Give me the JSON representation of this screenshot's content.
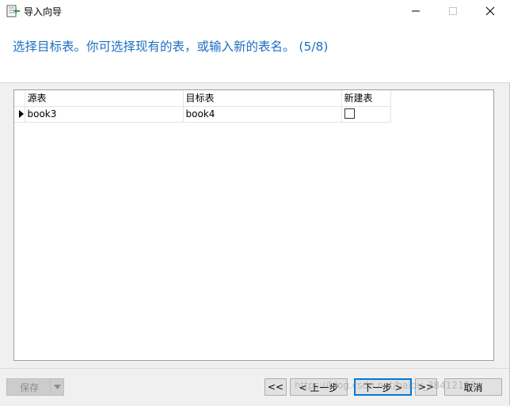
{
  "window": {
    "title": "导入向导"
  },
  "header": {
    "instruction": "选择目标表。你可选择现有的表，或输入新的表名。 (5/8)"
  },
  "grid": {
    "columns": {
      "source": "源表",
      "target": "目标表",
      "new_table": "新建表"
    },
    "rows": [
      {
        "source": "book3",
        "target": "book4",
        "new_table": false
      }
    ]
  },
  "footer": {
    "save_label": "保存",
    "first_label": "<<",
    "prev_label": "< 上一步",
    "next_label": "下一步 >",
    "last_label": ">>",
    "cancel_label": "取消"
  },
  "watermark": "https://blog.csdn.net/baidu_38412156",
  "colors": {
    "accent": "#1e6fc4",
    "primary_border": "#0078d7"
  }
}
